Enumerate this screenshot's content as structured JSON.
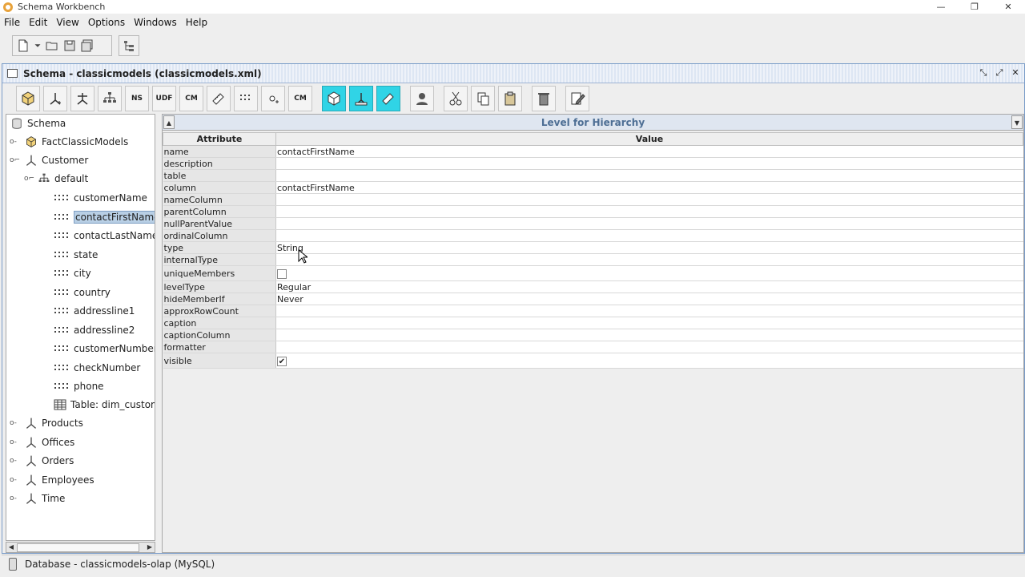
{
  "window": {
    "title": "Schema Workbench"
  },
  "menu": [
    "File",
    "Edit",
    "View",
    "Options",
    "Windows",
    "Help"
  ],
  "frame": {
    "title": "Schema - classicmodels (classicmodels.xml)"
  },
  "schema_toolbar": {
    "labels": [
      "NS",
      "UDF",
      "CM",
      "CM"
    ]
  },
  "tree": {
    "root": "Schema",
    "cube": "FactClassicModels",
    "customer": "Customer",
    "hierarchy": "default",
    "levels": [
      "customerName",
      "contactFirstName",
      "contactLastName",
      "state",
      "city",
      "country",
      "addressline1",
      "addressline2",
      "customerNumber",
      "checkNumber",
      "phone"
    ],
    "table": "Table: dim_custome",
    "dimensions": [
      "Products",
      "Offices",
      "Orders",
      "Employees",
      "Time"
    ]
  },
  "props": {
    "header": "Level for  Hierarchy",
    "col_attribute": "Attribute",
    "col_value": "Value",
    "rows": [
      {
        "attr": "name",
        "value": "contactFirstName"
      },
      {
        "attr": "description",
        "value": ""
      },
      {
        "attr": "table",
        "value": ""
      },
      {
        "attr": "column",
        "value": "contactFirstName"
      },
      {
        "attr": "nameColumn",
        "value": ""
      },
      {
        "attr": "parentColumn",
        "value": ""
      },
      {
        "attr": "nullParentValue",
        "value": ""
      },
      {
        "attr": "ordinalColumn",
        "value": ""
      },
      {
        "attr": "type",
        "value": "String"
      },
      {
        "attr": "internalType",
        "value": ""
      },
      {
        "attr": "uniqueMembers",
        "value": "",
        "checkbox": false
      },
      {
        "attr": "levelType",
        "value": "Regular"
      },
      {
        "attr": "hideMemberIf",
        "value": "Never"
      },
      {
        "attr": "approxRowCount",
        "value": ""
      },
      {
        "attr": "caption",
        "value": ""
      },
      {
        "attr": "captionColumn",
        "value": ""
      },
      {
        "attr": "formatter",
        "value": ""
      },
      {
        "attr": "visible",
        "value": "",
        "checkbox": true
      }
    ]
  },
  "status": {
    "text": "Database - classicmodels-olap (MySQL)"
  }
}
